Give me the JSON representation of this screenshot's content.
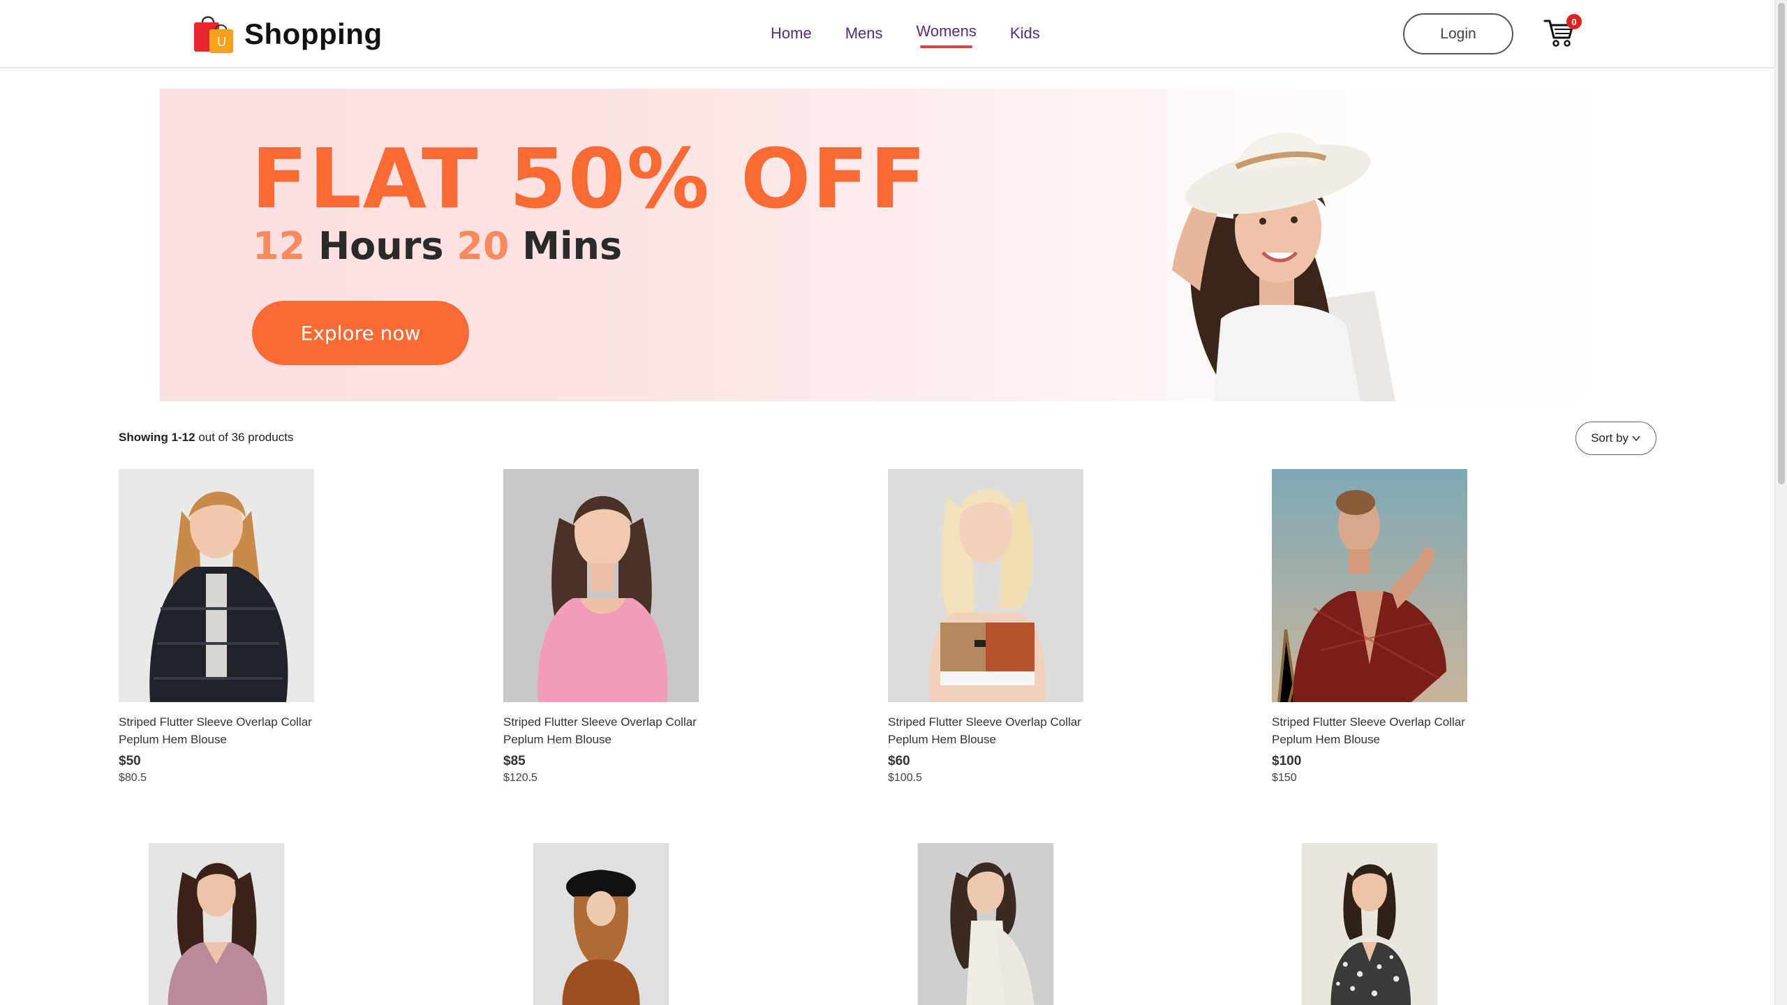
{
  "brand": {
    "name": "Shopping",
    "logo_letter": "U"
  },
  "nav": [
    {
      "label": "Home",
      "active": false
    },
    {
      "label": "Mens",
      "active": false
    },
    {
      "label": "Womens",
      "active": true
    },
    {
      "label": "Kids",
      "active": false
    }
  ],
  "header": {
    "login_label": "Login",
    "cart_count": "0"
  },
  "banner": {
    "headline": "FLAT 50% OFF",
    "hours_value": "12",
    "hours_label": "Hours",
    "mins_value": "20",
    "mins_label": "Mins",
    "cta_label": "Explore now"
  },
  "listing": {
    "showing_label": "Showing",
    "showing_range": "1-12",
    "showing_suffix": "out of 36 products",
    "sort_label": "Sort by"
  },
  "products": [
    {
      "name": "Striped Flutter Sleeve Overlap Collar Peplum Hem Blouse",
      "price": "$50",
      "old_price": "$80.5"
    },
    {
      "name": "Striped Flutter Sleeve Overlap Collar Peplum Hem Blouse",
      "price": "$85",
      "old_price": "$120.5"
    },
    {
      "name": "Striped Flutter Sleeve Overlap Collar Peplum Hem Blouse",
      "price": "$60",
      "old_price": "$100.5"
    },
    {
      "name": "Striped Flutter Sleeve Overlap Collar Peplum Hem Blouse",
      "price": "$100",
      "old_price": "$150"
    },
    {
      "name": "",
      "price": "",
      "old_price": ""
    },
    {
      "name": "",
      "price": "",
      "old_price": ""
    },
    {
      "name": "",
      "price": "",
      "old_price": ""
    },
    {
      "name": "",
      "price": "",
      "old_price": ""
    }
  ],
  "colors": {
    "accent": "#fa6a35",
    "nav_text": "#5b2a7a",
    "active_underline": "#e2413d",
    "badge": "#e02020"
  },
  "icons": [
    "shopping-bag-logo-icon",
    "cart-icon",
    "chevron-down-icon"
  ]
}
